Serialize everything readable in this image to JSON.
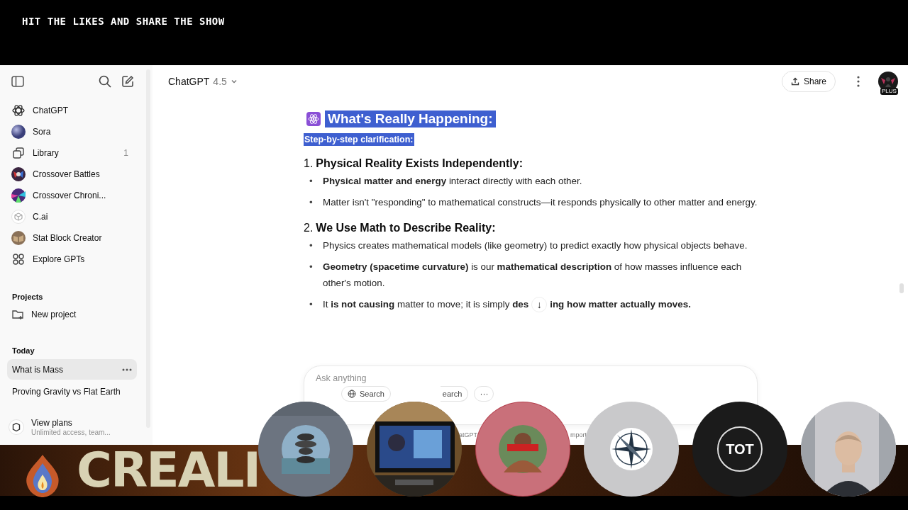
{
  "stream_overlay": {
    "top_caption": "HIT THE LIKES AND SHARE THE SHOW",
    "banner_text": "CREALI",
    "participants": [
      {
        "kind": "picture"
      },
      {
        "kind": "picture"
      },
      {
        "kind": "picture"
      },
      {
        "kind": "compass"
      },
      {
        "kind": "text",
        "label": "TOT"
      },
      {
        "kind": "picture"
      }
    ]
  },
  "sidebar": {
    "nav_items": [
      {
        "label": "ChatGPT"
      },
      {
        "label": "Sora"
      },
      {
        "label": "Library",
        "count": "1"
      },
      {
        "label": "Crossover Battles"
      },
      {
        "label": "Crossover Chroni..."
      },
      {
        "label": "C.ai"
      },
      {
        "label": "Stat Block Creator"
      },
      {
        "label": "Explore GPTs"
      }
    ],
    "projects_heading": "Projects",
    "new_project": "New project",
    "today_heading": "Today",
    "chats": [
      {
        "label": "What is Mass",
        "selected": true
      },
      {
        "label": "Proving Gravity vs Flat Earth",
        "selected": false
      }
    ],
    "plans": {
      "title": "View plans",
      "subtitle": "Unlimited access, team..."
    }
  },
  "header": {
    "model": "ChatGPT",
    "version": "4.5",
    "share": "Share",
    "avatar_badge": "PLUS"
  },
  "message": {
    "title": {
      "text": "What's Really Happening:",
      "selected": true
    },
    "subtitle": {
      "text": "Step-by-step clarification:",
      "selected": true
    },
    "sections": [
      {
        "number": "1.",
        "heading": "Physical Reality Exists Independently:",
        "bullets": [
          {
            "marker": "•",
            "segments": [
              "**Physical matter and energy** interact directly with each other."
            ]
          },
          {
            "marker": "•",
            "segments": [
              "Matter isn't \"responding\" to mathematical constructs—it responds physically to other matter and energy."
            ]
          }
        ]
      },
      {
        "number": "2.",
        "heading": "We Use Math to Describe Reality:",
        "bullets": [
          {
            "marker": "•",
            "segments": [
              "Physics creates mathematical models (like geometry) to predict exactly how physical objects behave."
            ]
          },
          {
            "marker": "•",
            "segments": [
              "**Geometry (spacetime curvature)** is our **mathematical description** of how masses influence each other's motion."
            ]
          },
          {
            "marker": "•",
            "segments": [
              "It **is not causing** matter to move; it is simply **des**",
              "**ing how matter actually moves.**"
            ]
          }
        ]
      }
    ],
    "scroll_down": "↓"
  },
  "composer": {
    "placeholder": "Ask anything",
    "tools": [
      "Search",
      "earch"
    ],
    "more": "···"
  },
  "footer_fragments": [
    "atGPT",
    "mport"
  ]
}
